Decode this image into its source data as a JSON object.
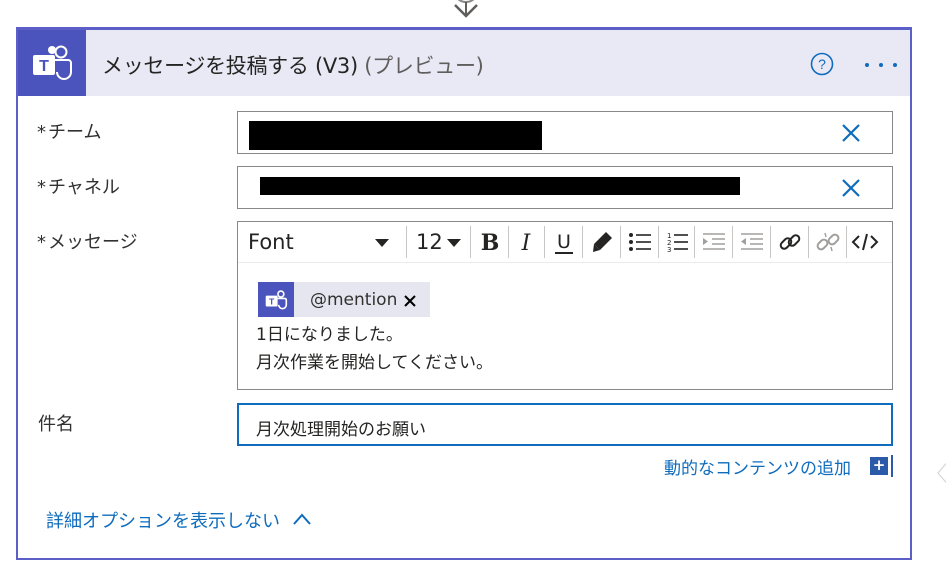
{
  "action": {
    "title": "メッセージを投稿する (V3)",
    "preview_tag": "(プレビュー)"
  },
  "fields": {
    "team": {
      "label": "チーム",
      "required_mark": "*"
    },
    "channel": {
      "label": "チャネル",
      "required_mark": "*"
    },
    "message": {
      "label": "メッセージ",
      "required_mark": "*"
    },
    "subject": {
      "label": "件名",
      "value": "月次処理開始のお願い"
    }
  },
  "editor": {
    "font_label": "Font",
    "size_label": "12",
    "mention": {
      "text": "@mention"
    },
    "lines": [
      "1日になりました。",
      "月次作業を開始してください。"
    ]
  },
  "dynamic_content_link": "動的なコンテンツの追加",
  "advanced_options_link": "詳細オプションを表示しない",
  "colors": {
    "accent": "#5b5fc7",
    "teams_brand": "#4b53bc",
    "link": "#0f6cbd",
    "header_bg": "#e9e9f6"
  },
  "icons": {
    "header_logo": "teams-logo-icon",
    "help": "help-circle-icon",
    "more": "more-options-icon",
    "clear": "clear-icon",
    "bold": "bold-icon",
    "italic": "italic-icon",
    "underline": "underline-icon",
    "highlight": "highlighter-icon",
    "bullets": "bulleted-list-icon",
    "numbers": "numbered-list-icon",
    "indent_increase": "increase-indent-icon",
    "indent_decrease": "decrease-indent-icon",
    "link": "link-icon",
    "unlink": "unlink-icon",
    "code": "code-view-icon",
    "collapse": "chevron-up-icon"
  }
}
